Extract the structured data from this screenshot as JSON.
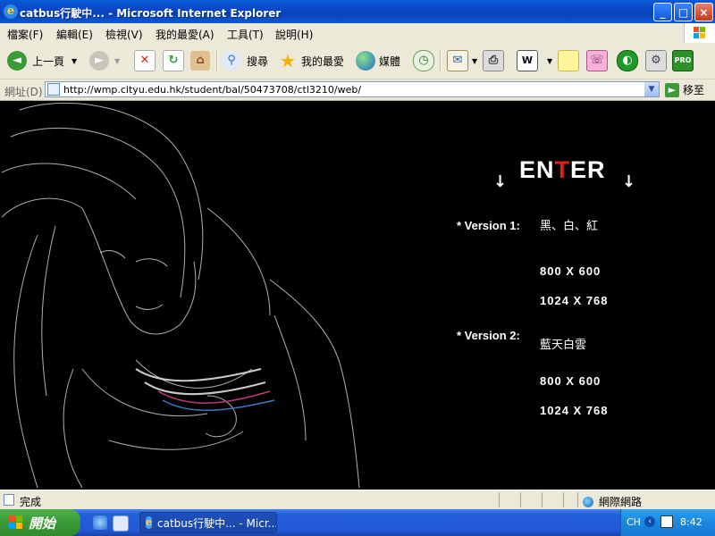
{
  "window": {
    "title": "catbus行駛中... - Microsoft Internet Explorer",
    "controls": [
      "_",
      "□",
      "×"
    ]
  },
  "menu": {
    "items": [
      "檔案(F)",
      "編輯(E)",
      "檢視(V)",
      "我的最愛(A)",
      "工具(T)",
      "說明(H)"
    ]
  },
  "toolbar": {
    "back_label": "上一頁",
    "search_label": "搜尋",
    "favorites_label": "我的最愛",
    "media_label": "媒體"
  },
  "address": {
    "label": "網址(D)",
    "url": "http://wmp.cityu.edu.hk/student/bal/50473708/ctl3210/web/",
    "go_label": "移至"
  },
  "page": {
    "enter_prefix": "EN",
    "enter_red": "T",
    "enter_suffix": "ER",
    "arrow": "↓",
    "versions": [
      {
        "label": "* Version 1:",
        "name": "黑、白、紅",
        "resolutions": [
          "800 X 600",
          "1024 X 768"
        ]
      },
      {
        "label": "* Version 2:",
        "name": "藍天白雲",
        "resolutions": [
          "800 X 600",
          "1024 X 768"
        ]
      }
    ],
    "accent_color": "#e02020"
  },
  "status": {
    "text": "完成",
    "zone": "網際網路"
  },
  "taskbar": {
    "start_label": "開始",
    "task_label": "catbus行駛中... - Micr...",
    "lang": "CH",
    "clock": "8:42"
  }
}
